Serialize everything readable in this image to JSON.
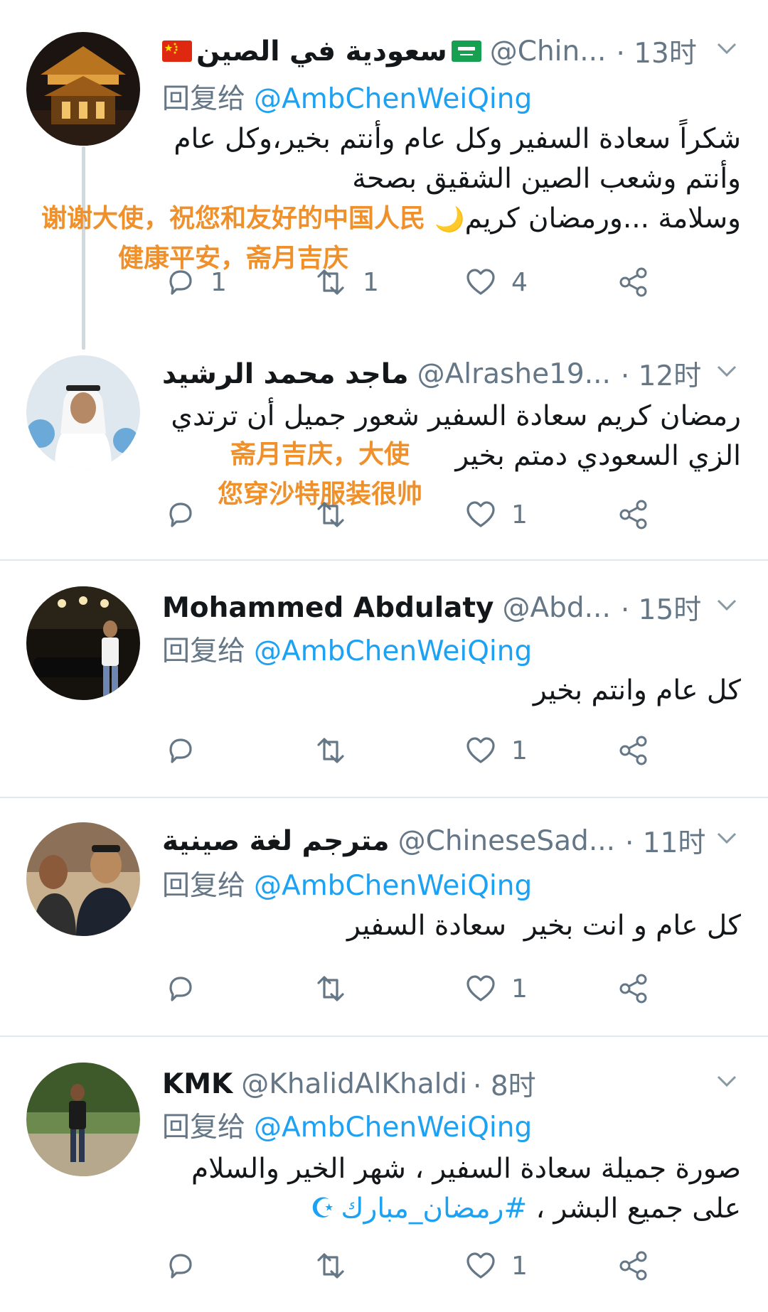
{
  "tweets": [
    {
      "name": "سعودية في الصين",
      "handle": "@Chin...",
      "time": "· 13时",
      "reply_label": "回复给",
      "reply_to": "@AmbChenWeiQing",
      "text": "شكراً سعادة السفير وكل عام وأنتم بخير،وكل عام\nوأنتم وشعب الصين الشقيق بصحة\nوسلامة ...ورمضان كريم",
      "text_emoji": "🌙",
      "translation": [
        "谢谢大使，祝您和友好的中国人民",
        "健康平安，斋月吉庆"
      ],
      "counts": {
        "reply": "1",
        "retweet": "1",
        "like": "4"
      }
    },
    {
      "name": "ماجد محمد الرشيد",
      "handle": "@Alrashe19...",
      "time": "· 12时",
      "text": "رمضان كريم سعادة السفير شعور جميل أن ترتدي\nالزي السعودي دمتم بخير",
      "translation": [
        "斋月吉庆，大使",
        "您穿沙特服装很帅"
      ],
      "counts": {
        "reply": "",
        "retweet": "",
        "like": "1"
      }
    },
    {
      "name": "Mohammed Abdulaty",
      "handle": "@Abd...",
      "time": "· 15时",
      "reply_label": "回复给",
      "reply_to": "@AmbChenWeiQing",
      "text": "كل عام وانتم بخير",
      "counts": {
        "reply": "",
        "retweet": "",
        "like": "1"
      }
    },
    {
      "name": "مترجم لغة صينية",
      "handle": "@ChineseSad...",
      "time": "· 11时",
      "reply_label": "回复给",
      "reply_to": "@AmbChenWeiQing",
      "text": "كل عام و انت بخير  سعادة السفير",
      "counts": {
        "reply": "",
        "retweet": "",
        "like": "1"
      }
    },
    {
      "name": "KMK",
      "handle": "@KhalidAlKhaldi",
      "time": "· 8时",
      "reply_label": "回复给",
      "reply_to": "@AmbChenWeiQing",
      "text": "صورة جميلة سعادة السفير ، شهر الخير والسلام\nعلى جميع البشر ، ",
      "hashtag": "#رمضان_مبارك",
      "hashtag_emoji": "☪",
      "counts": {
        "reply": "",
        "retweet": "",
        "like": "1"
      }
    }
  ],
  "colors": {
    "link": "#1da1f2",
    "muted": "#657786",
    "translation": "#f0902a",
    "divider": "#e1e8ed"
  },
  "icons": [
    "china-flag-icon",
    "saudi-flag-icon",
    "chevron-down-icon",
    "reply-icon",
    "retweet-icon",
    "like-icon",
    "share-icon"
  ]
}
